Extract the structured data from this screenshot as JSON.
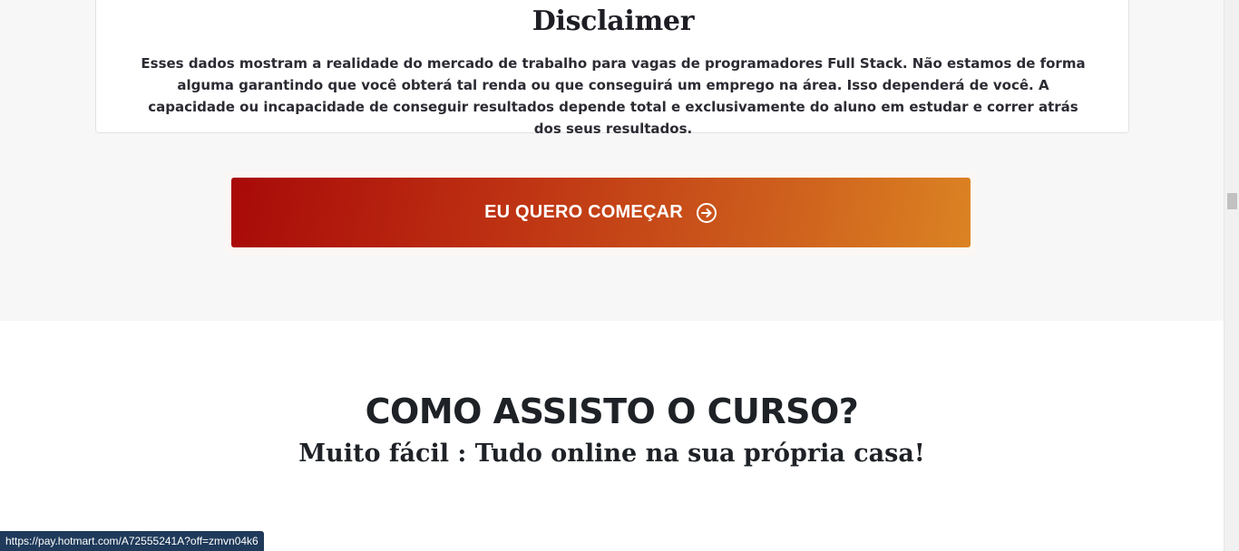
{
  "disclaimer": {
    "title": "Disclaimer",
    "text": "Esses dados mostram a realidade do mercado de trabalho para vagas de programadores Full Stack. Não estamos de forma alguma garantindo que você obterá tal renda ou que conseguirá um emprego na área. Isso dependerá de você. A capacidade ou incapacidade de conseguir resultados depende total e exclusivamente do aluno em estudar e correr atrás dos seus resultados."
  },
  "cta": {
    "label": "EU QUERO COMEÇAR",
    "icon": "arrow-right-circle-icon",
    "gradient_start": "#a80a08",
    "gradient_end": "#db8323"
  },
  "section": {
    "heading": "COMO ASSISTO O CURSO?",
    "subheading": "Muito fácil : Tudo online na sua própria casa!"
  },
  "status_bar": {
    "url": "https://pay.hotmart.com/A72555241A?off=zmvn04k6"
  },
  "colors": {
    "gray_background": "#f7f7f8",
    "heading_text": "#1e2227",
    "status_bar": "#1f3a5a"
  }
}
